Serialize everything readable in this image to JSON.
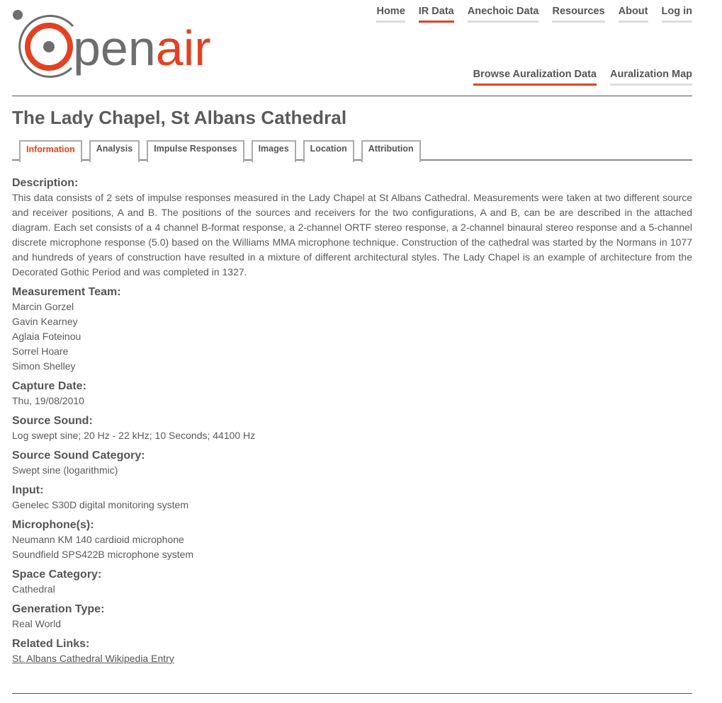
{
  "logo": {
    "text_dark": "pen",
    "text_accent": "air",
    "accent_color": "#e34122",
    "gray_color": "#6d6d6d"
  },
  "nav_primary": [
    {
      "label": "Home",
      "active": false
    },
    {
      "label": "IR Data",
      "active": true
    },
    {
      "label": "Anechoic Data",
      "active": false
    },
    {
      "label": "Resources",
      "active": false
    },
    {
      "label": "About",
      "active": false
    },
    {
      "label": "Log in",
      "active": false
    }
  ],
  "nav_secondary": [
    {
      "label": "Browse Auralization Data",
      "active": true
    },
    {
      "label": "Auralization Map",
      "active": false
    }
  ],
  "page_title": "The Lady Chapel, St Albans Cathedral",
  "tabs": [
    {
      "label": "Information",
      "active": true
    },
    {
      "label": "Analysis",
      "active": false
    },
    {
      "label": "Impulse Responses",
      "active": false
    },
    {
      "label": "Images",
      "active": false
    },
    {
      "label": "Location",
      "active": false
    },
    {
      "label": "Attribution",
      "active": false
    }
  ],
  "fields": {
    "description": {
      "label": "Description:",
      "text": "This data consists of 2 sets of impulse responses measured in the Lady Chapel at St Albans Cathedral. Measurements were taken at two different source and receiver positions, A and B. The positions of the sources and receivers for the two configurations, A and B, can be are described in the attached diagram. Each set consists of a 4 channel B-format response, a 2-channel ORTF stereo response, a 2-channel binaural stereo response and a 5-channel discrete microphone response (5.0) based on the Williams MMA microphone technique. Construction of the cathedral was started by the Normans in 1077 and hundreds of years of construction have resulted in a mixture of different architectural styles. The Lady Chapel is an example of architecture from the Decorated Gothic Period and was completed in 1327."
    },
    "team": {
      "label": "Measurement Team:",
      "members": [
        "Marcin Gorzel",
        "Gavin Kearney",
        "Aglaia Foteinou",
        "Sorrel Hoare",
        "Simon Shelley"
      ]
    },
    "capture_date": {
      "label": "Capture Date:",
      "value": "Thu, 19/08/2010"
    },
    "source_sound": {
      "label": "Source Sound:",
      "value": "Log swept sine; 20 Hz - 22 kHz; 10 Seconds; 44100 Hz"
    },
    "source_sound_category": {
      "label": "Source Sound Category:",
      "value": "Swept sine (logarithmic)"
    },
    "input": {
      "label": "Input:",
      "value": "Genelec S30D digital monitoring system"
    },
    "microphones": {
      "label": "Microphone(s):",
      "values": [
        "Neumann KM 140 cardioid microphone",
        "Soundfield SPS422B microphone system"
      ]
    },
    "space_category": {
      "label": "Space Category:",
      "value": "Cathedral"
    },
    "generation_type": {
      "label": "Generation Type:",
      "value": "Real World"
    },
    "related_links": {
      "label": "Related Links:",
      "link_text": "St. Albans Cathedral Wikipedia Entry"
    }
  }
}
